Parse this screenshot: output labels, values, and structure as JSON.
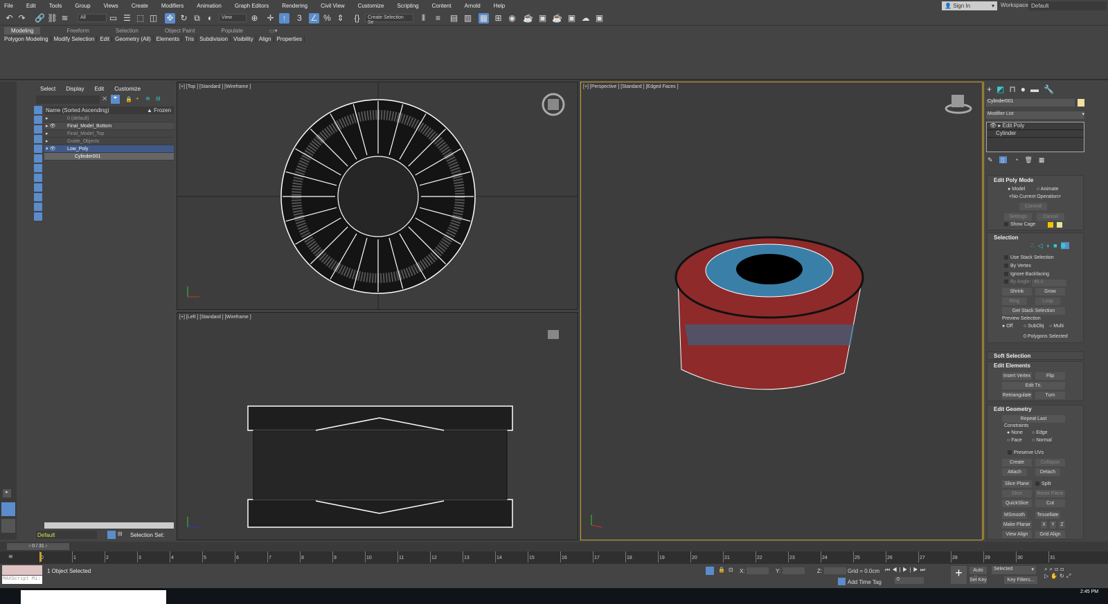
{
  "menu": [
    "File",
    "Edit",
    "Tools",
    "Group",
    "Views",
    "Create",
    "Modifiers",
    "Animation",
    "Graph Editors",
    "Rendering",
    "Civil View",
    "Customize",
    "Scripting",
    "Content",
    "Arnold",
    "Help"
  ],
  "account": {
    "sign_in": "Sign In",
    "workspaces_label": "Workspaces:",
    "workspace": "Default"
  },
  "toolbar": {
    "filter": "All",
    "ref_coord": "View",
    "named_selection": "Create Selection Se",
    "snap3": "3",
    "percent": "%"
  },
  "ribbon": {
    "tabs": [
      "Modeling",
      "Freeform",
      "Selection",
      "Object Paint",
      "Populate"
    ],
    "subtabs": [
      "Polygon Modeling",
      "Modify Selection",
      "Edit",
      "Geometry (All)",
      "Elements",
      "Tris",
      "Subdivision",
      "Visibility",
      "Align",
      "Properties"
    ]
  },
  "explorer": {
    "menu": [
      "Select",
      "Display",
      "Edit",
      "Customize"
    ],
    "col_name": "Name (Sorted Ascending)",
    "col_frozen": "Frozen",
    "rows": [
      "0 (default)",
      "Final_Model_Bottom",
      "Final_Model_Top",
      "Guide_Objects",
      "Low_Poly",
      "Cylinder001"
    ],
    "layer": "Default",
    "selection_sets": "Selection Set:"
  },
  "viewports": {
    "top": "[+] [Top ] [Standard ] [Wireframe ]",
    "left": "[+] [Left ] [Standard ] [Wireframe ]",
    "persp": "[+] [Perspective ] [Standard ] [Edged Faces ]"
  },
  "command": {
    "object_name": "Cylinder001",
    "modifier_list": "Modifier List",
    "stack": [
      "Edit Poly",
      "Cylinder"
    ],
    "edit_poly_mode": {
      "title": "Edit Poly Mode",
      "model": "Model",
      "animate": "Animate",
      "operation": "<No Current Operation>",
      "commit": "Commit",
      "settings": "Settings",
      "cancel": "Cancel",
      "show_cage": "Show Cage"
    },
    "selection": {
      "title": "Selection",
      "use_stack": "Use Stack Selection",
      "by_vertex": "By Vertex",
      "ignore_backfacing": "Ignore Backfacing",
      "by_angle": "By Angle:",
      "angle": "45.0",
      "shrink": "Shrink",
      "grow": "Grow",
      "ring": "Ring",
      "loop": "Loop",
      "get_stack": "Get Stack Selection",
      "preview": "Preview Selection",
      "off": "Off",
      "subobj": "SubObj",
      "multi": "Multi",
      "count": "0 Polygons Selected"
    },
    "soft_selection": "Soft Selection",
    "edit_elements": {
      "title": "Edit Elements",
      "insert_vertex": "Insert Vertex",
      "flip": "Flip",
      "edit_tri": "Edit Tri.",
      "retriangulate": "Retriangulate",
      "turn": "Turn"
    },
    "edit_geometry": {
      "title": "Edit Geometry",
      "repeat_last": "Repeat Last",
      "constraints": "Constraints",
      "none": "None",
      "edge": "Edge",
      "face": "Face",
      "normal": "Normal",
      "preserve_uvs": "Preserve UVs",
      "create": "Create",
      "collapse": "Collapse",
      "attach": "Attach",
      "detach": "Detach",
      "slice_plane": "Slice Plane",
      "split": "Split",
      "slice": "Slice",
      "reset_plane": "Reset Plane",
      "quickslice": "QuickSlice",
      "cut": "Cut",
      "msmooth": "MSmooth",
      "tessellate": "Tessellate",
      "make_planar": "Make Planar",
      "x": "X",
      "y": "Y",
      "z": "Z",
      "view_align": "View Align",
      "grid_align": "Grid Align"
    }
  },
  "timeline": {
    "frame": "0 / 31",
    "ticks": [
      "0",
      "1",
      "2",
      "3",
      "4",
      "5",
      "6",
      "7",
      "8",
      "9",
      "10",
      "11",
      "12",
      "13",
      "14",
      "15",
      "16",
      "17",
      "18",
      "19",
      "20",
      "21",
      "22",
      "23",
      "24",
      "25",
      "26",
      "27",
      "28",
      "29",
      "30",
      "31"
    ]
  },
  "status": {
    "maxscript": "MAXScript Mi:",
    "selected": "1 Object Selected",
    "x": "X:",
    "y": "Y:",
    "z": "Z:",
    "grid": "Grid = 0.0cm",
    "add_time_tag": "Add Time Tag",
    "frame": "0",
    "auto_key": "Auto Key",
    "set_key": "Set Key",
    "key_mode": "Selected",
    "key_filters": "Key Filters...",
    "clock": "2:45 PM"
  },
  "colors": {
    "accent": "#5b8ccc",
    "active_border": "#c9a227",
    "poly_red": "#9b2c2c",
    "poly_blue": "#3a7fa8"
  }
}
